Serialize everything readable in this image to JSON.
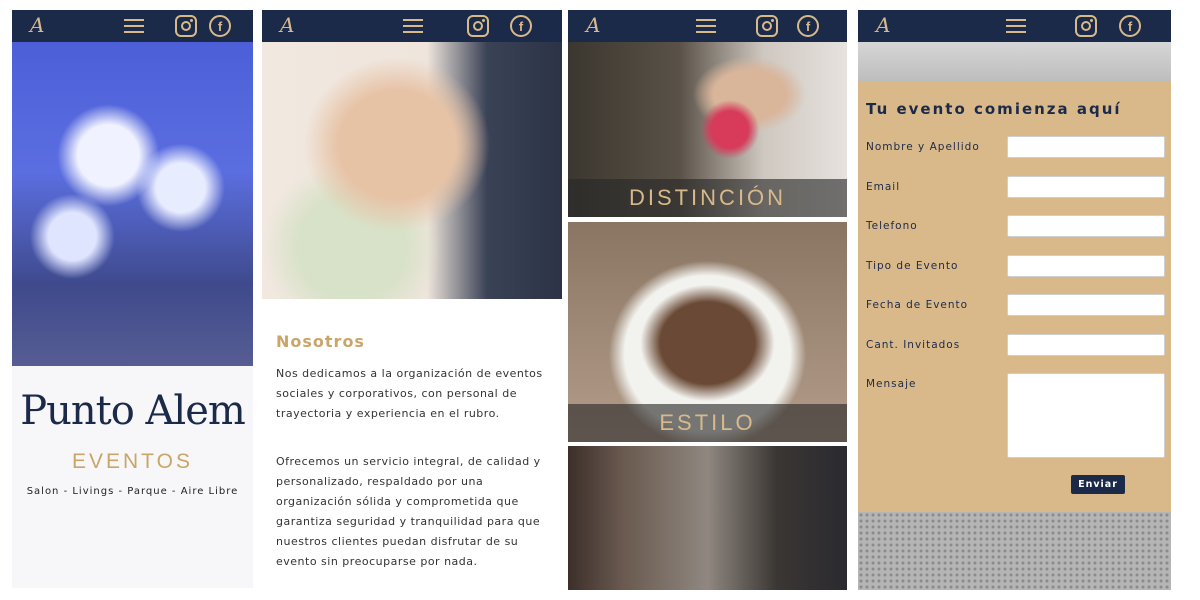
{
  "nav": {
    "logo_text": "A",
    "icons": [
      "menu-icon",
      "instagram-icon",
      "facebook-icon"
    ],
    "facebook_glyph": "f"
  },
  "panel1": {
    "brand": "Punto Alem",
    "subtitle": "EVENTOS",
    "tags": "Salon - Livings - Parque - Aire Libre"
  },
  "panel2": {
    "heading": "Nosotros",
    "paragraph1": "Nos dedicamos a la organización de eventos sociales y corporativos, con personal de trayectoria y experiencia en el rubro.",
    "paragraph2": "Ofrecemos un servicio integral, de calidad y personalizado, respaldado por una organización sólida y comprometida que garantiza seguridad y tranquilidad para que nuestros clientes puedan disfrutar de su evento sin preocuparse por nada."
  },
  "panel3": {
    "caption1": "DISTINCIÓN",
    "caption2": "ESTILO"
  },
  "panel4": {
    "title": "Tu evento comienza aquí",
    "fields": {
      "name": "Nombre y Apellido",
      "email": "Email",
      "phone": "Telefono",
      "event_type": "Tipo de Evento",
      "event_date": "Fecha de Evento",
      "guests": "Cant. Invitados",
      "message": "Mensaje"
    },
    "submit": "Enviar"
  },
  "colors": {
    "navy": "#1c2a4a",
    "gold": "#c9a56a",
    "form_bg": "#d9b98a"
  }
}
